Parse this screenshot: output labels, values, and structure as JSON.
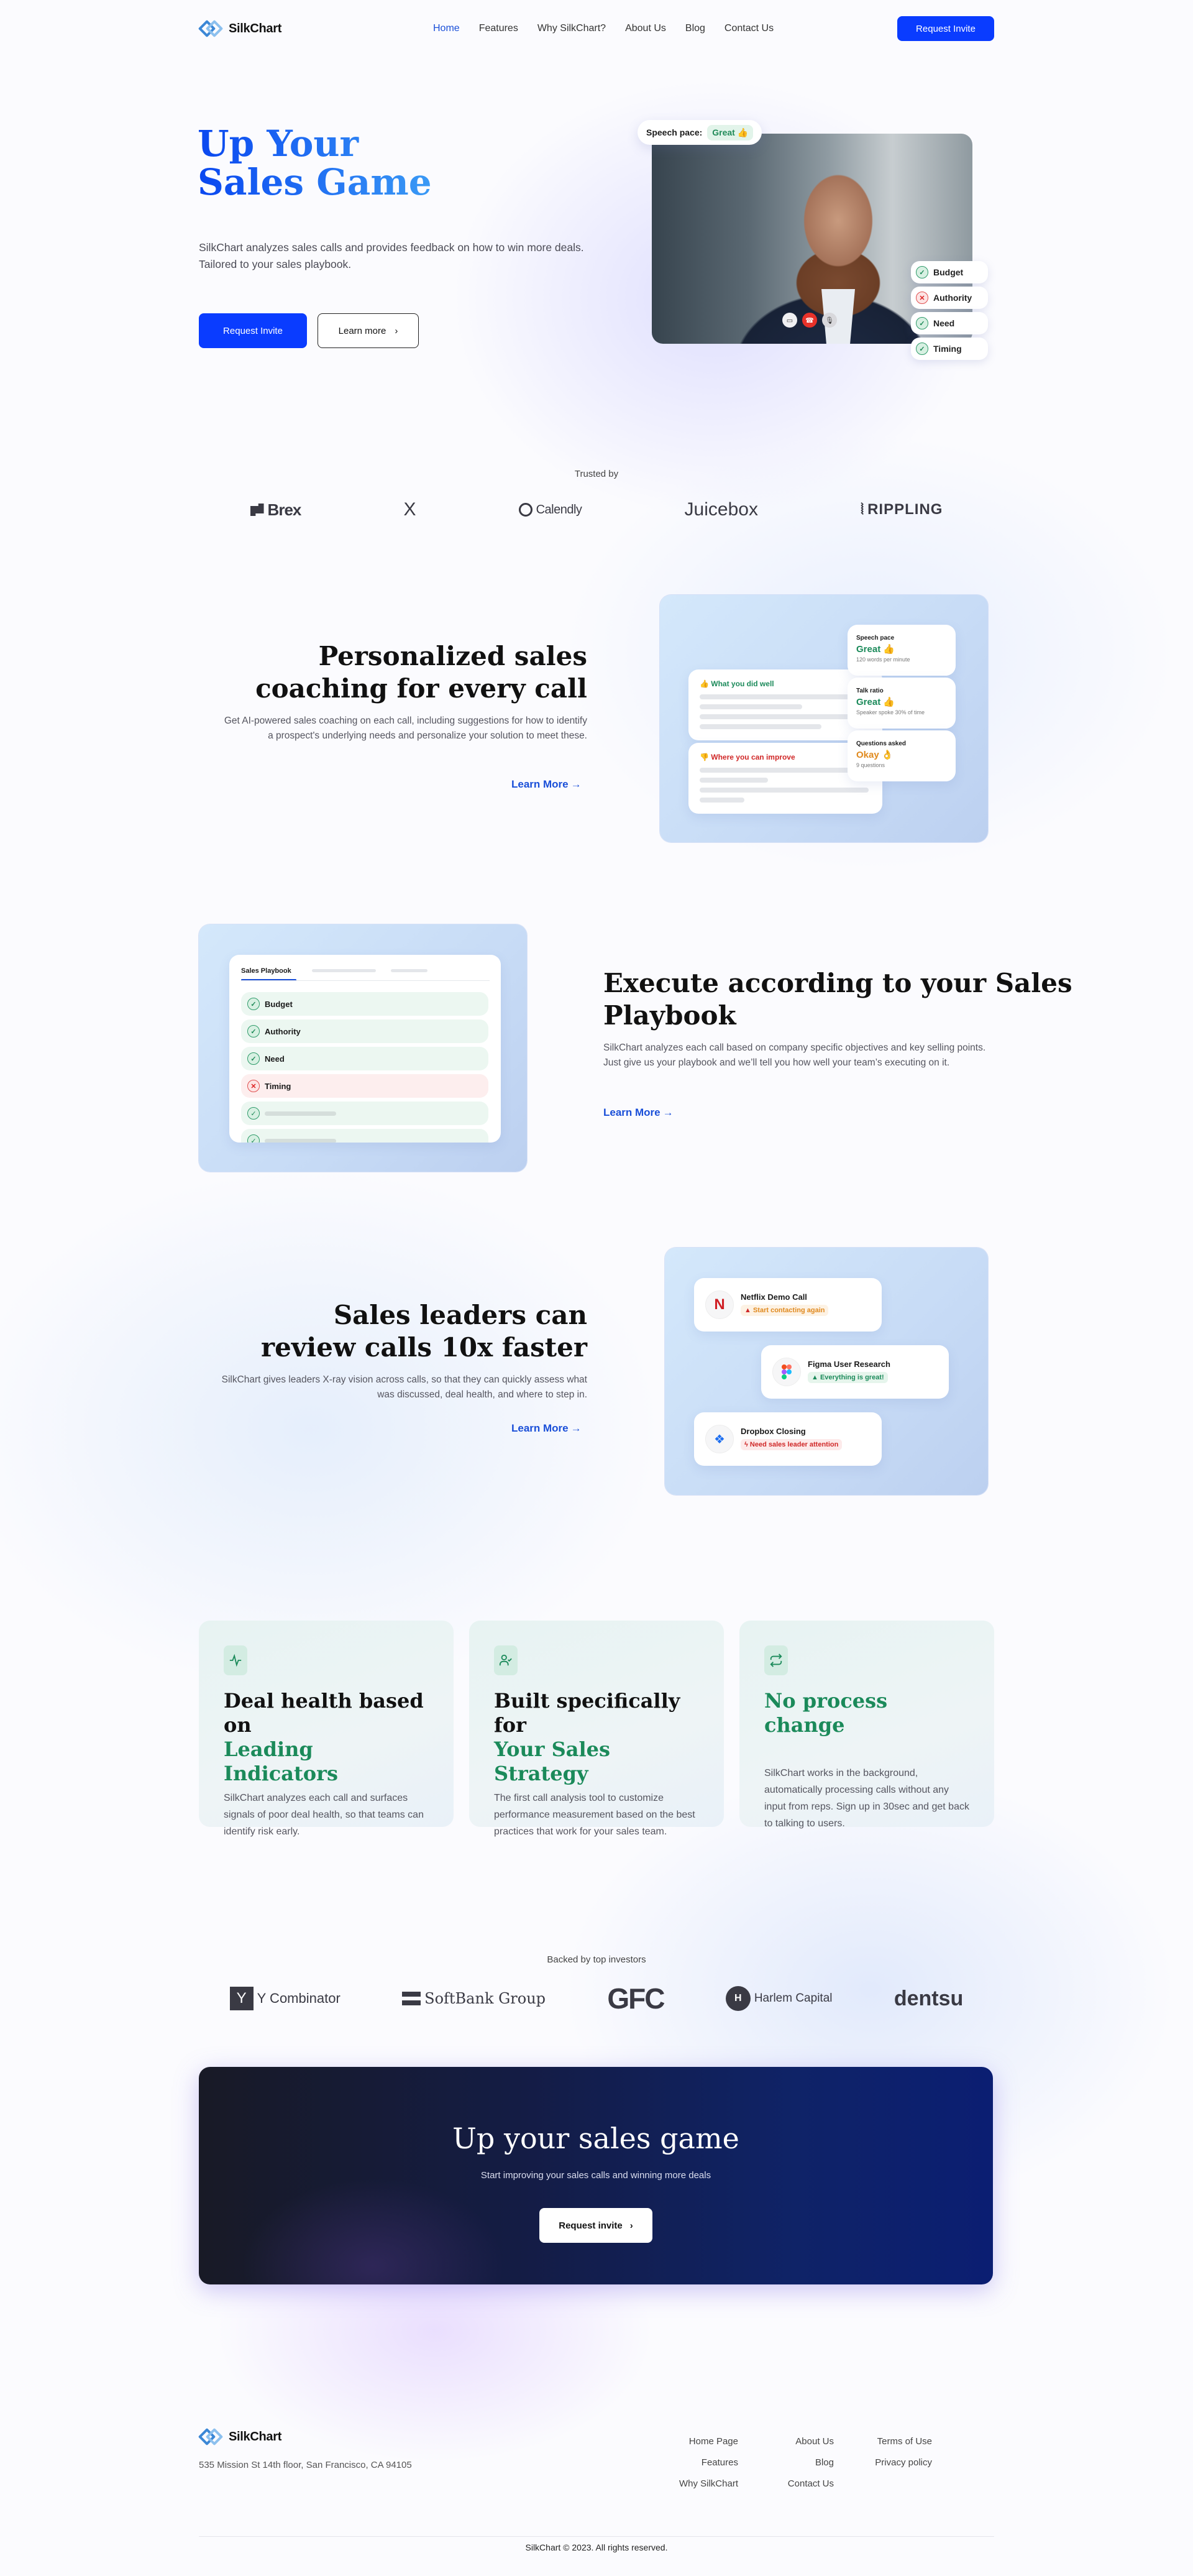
{
  "brand": {
    "name": "SilkChart",
    "accent": "#0a3cff",
    "green": "#1b8a5a"
  },
  "nav": {
    "links": [
      {
        "label": "Home",
        "active": true
      },
      {
        "label": "Features"
      },
      {
        "label": "Why SilkChart?"
      },
      {
        "label": "About Us"
      },
      {
        "label": "Blog"
      },
      {
        "label": "Contact Us"
      }
    ],
    "cta": "Request Invite"
  },
  "hero": {
    "title_line1": "Up Your",
    "title_line2": "Sales Game",
    "description": "SilkChart analyzes sales calls and provides feedback on how to win more deals. Tailored to your sales playbook.",
    "primary_button": "Request Invite",
    "secondary_button": "Learn more",
    "speech_pace_label": "Speech pace:",
    "speech_pace_value": "Great 👍",
    "call_controls": [
      "camera-icon",
      "hang-up-icon",
      "microphone-icon"
    ],
    "bant": [
      {
        "label": "Budget",
        "ok": true
      },
      {
        "label": "Authority",
        "ok": false
      },
      {
        "label": "Need",
        "ok": true
      },
      {
        "label": "Timing",
        "ok": true
      }
    ]
  },
  "trusted": {
    "label": "Trusted by",
    "logos": [
      "Brex",
      "X",
      "Calendly",
      "Juicebox",
      "RIPPLING"
    ]
  },
  "coaching": {
    "title_line1": "Personalized sales",
    "title_line2": "coaching for every call",
    "description": "Get AI-powered sales coaching on each call, including suggestions for how to identify a prospect's underlying needs and personalize your solution to meet these.",
    "link": "Learn More",
    "well_label": "👍 What you did well",
    "improve_label": "👎 Where you can improve",
    "metrics": [
      {
        "title": "Speech pace",
        "value": "Great 👍",
        "tone": "good",
        "detail": "120 words per minute"
      },
      {
        "title": "Talk ratio",
        "value": "Great 👍",
        "tone": "good",
        "detail": "Speaker spoke 30% of time"
      },
      {
        "title": "Questions asked",
        "value": "Okay 👌",
        "tone": "ok",
        "detail": "9 questions"
      }
    ]
  },
  "playbook": {
    "title_line1": "Execute according to your Sales",
    "title_line2": "Playbook",
    "description": "SilkChart analyzes each call based on company specific objectives and key selling points. Just give us your playbook and we’ll tell you how well your team’s executing on it.",
    "link": "Learn More",
    "tab_label": "Sales Playbook",
    "items": [
      {
        "label": "Budget",
        "ok": true
      },
      {
        "label": "Authority",
        "ok": true
      },
      {
        "label": "Need",
        "ok": true
      },
      {
        "label": "Timing",
        "ok": false
      }
    ]
  },
  "leaders": {
    "title_line1": "Sales leaders can",
    "title_line2": "review calls 10x faster",
    "description": "SilkChart gives leaders X-ray vision across calls, so that they can quickly assess what was discussed, deal health, and where to step in.",
    "link": "Learn More",
    "calls": [
      {
        "name": "Netflix Demo Call",
        "status": "Start contacting again",
        "tone": "warn",
        "icon": "netflix-logo-icon"
      },
      {
        "name": "Figma User Research",
        "status": "Everything is great!",
        "tone": "good",
        "icon": "figma-logo-icon"
      },
      {
        "name": "Dropbox Closing",
        "status": "Need sales leader attention",
        "tone": "bad",
        "icon": "dropbox-logo-icon"
      }
    ]
  },
  "benefits": [
    {
      "title": "Deal health based on",
      "highlight": "Leading Indicators",
      "text": "SilkChart analyzes each call and surfaces signals of poor deal health, so that teams can identify risk early.",
      "icon": "activity-pulse-icon"
    },
    {
      "title": "Built specifically for",
      "highlight": "Your Sales Strategy",
      "text": "The first call analysis tool to customize performance measurement based on the best practices that work for your sales team.",
      "icon": "user-check-icon"
    },
    {
      "title": "",
      "highlight": "No process change",
      "text": "SilkChart works in the background, automatically processing calls without any input from reps. Sign up in 30sec and get back to talking to users.",
      "icon": "repeat-arrows-icon"
    }
  ],
  "investors": {
    "label": "Backed by top investors",
    "logos": [
      "Y Combinator",
      "SoftBank Group",
      "GFC",
      "Harlem Capital",
      "dentsu"
    ]
  },
  "cta": {
    "title": "Up your sales game",
    "subtitle": "Start improving your sales calls and winning more deals",
    "button": "Request invite"
  },
  "footer": {
    "address": "535 Mission St 14th floor,  San Francisco, CA 94105",
    "col1": [
      "Home Page",
      "Features",
      "Why SilkChart"
    ],
    "col2": [
      "About Us",
      "Blog",
      "Contact Us"
    ],
    "col3": [
      "Terms of Use",
      "Privacy policy"
    ],
    "copyright": "SilkChart © 2023. All rights reserved."
  }
}
